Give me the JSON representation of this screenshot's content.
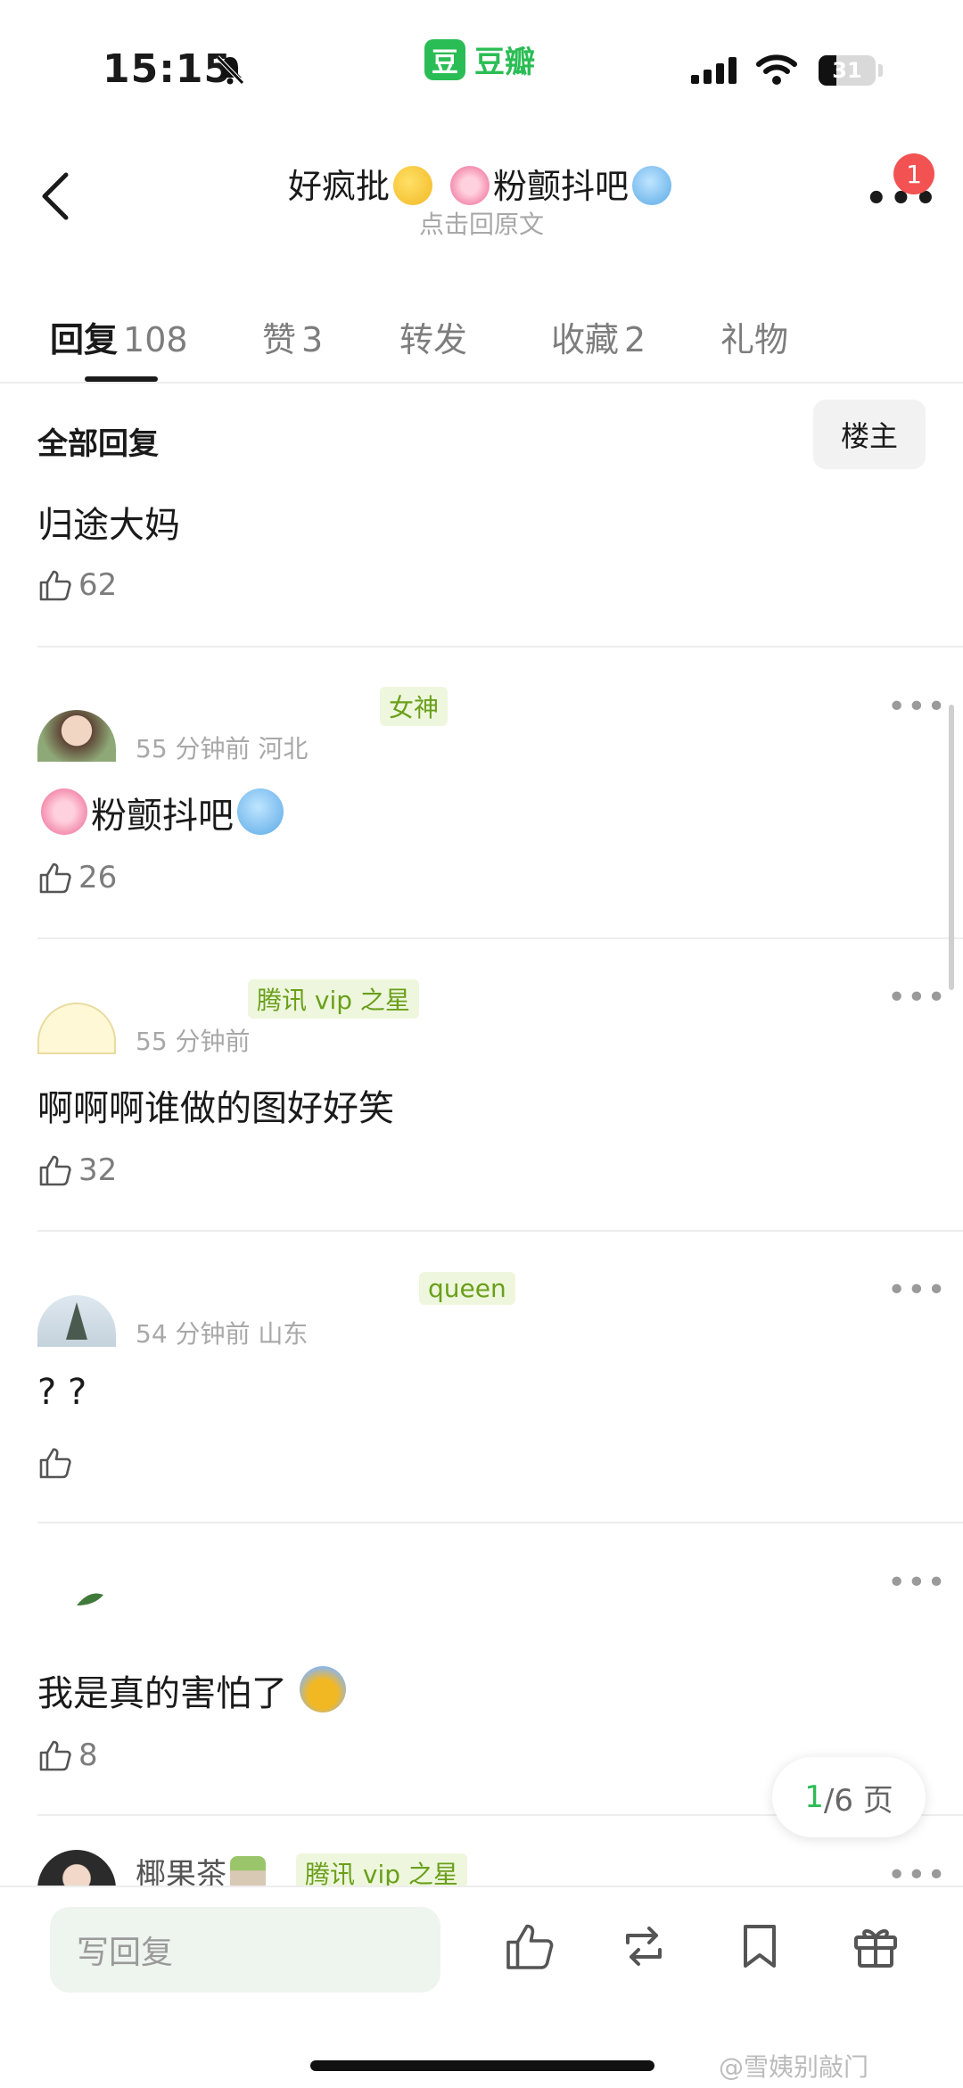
{
  "status_bar": {
    "time": "15:15",
    "app_logo_char": "豆",
    "app_name": "豆瓣",
    "battery": "31",
    "battery_level": 0.31
  },
  "nav": {
    "title_prefix": "好疯批",
    "title_suffix": "粉颤抖吧",
    "subtitle": "点击回原文",
    "notification_count": "1"
  },
  "tabs": [
    {
      "label": "回复",
      "count": "108"
    },
    {
      "label": "赞",
      "count": "3"
    },
    {
      "label": "转发",
      "count": ""
    },
    {
      "label": "收藏",
      "count": "2"
    },
    {
      "label": "礼物",
      "count": ""
    }
  ],
  "section": {
    "title": "全部回复",
    "owner_button": "楼主"
  },
  "first_reply": {
    "text": "归途大妈",
    "likes": "62"
  },
  "comments": [
    {
      "badge": "女神",
      "meta": "55 分钟前 河北",
      "text": "粉颤抖吧",
      "likes": "26"
    },
    {
      "badge": "腾讯 vip 之星",
      "meta": "55 分钟前",
      "text": "啊啊啊谁做的图好好笑",
      "likes": "32"
    },
    {
      "badge": "queen",
      "meta": "54 分钟前 山东",
      "text": "? ?",
      "likes": ""
    },
    {
      "badge": "",
      "meta": "",
      "text": "我是真的害怕了",
      "likes": "8"
    },
    {
      "name": "椰果茶",
      "badge": "腾讯 vip 之星"
    }
  ],
  "page_indicator": {
    "current": "1",
    "total": "/6 页"
  },
  "bottom_bar": {
    "reply_placeholder": "写回复"
  },
  "watermark": "@雪姨别敲门",
  "colors": {
    "accent": "#2bbd55",
    "vip_text": "#6a9f1a",
    "badge_red": "#f35252"
  }
}
